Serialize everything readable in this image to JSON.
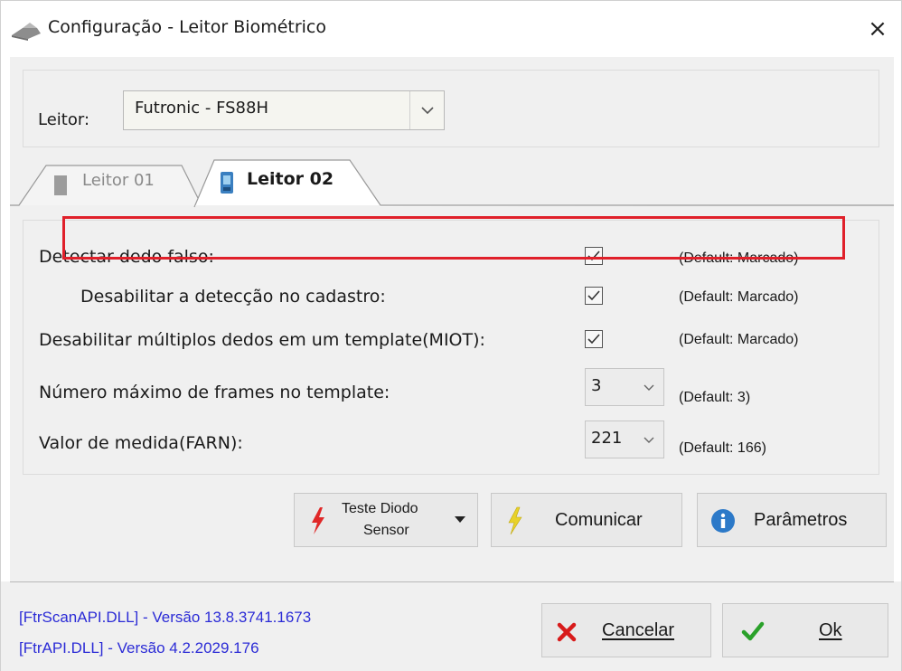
{
  "window": {
    "title": "Configuração - Leitor Biométrico",
    "close_glyph": "×"
  },
  "leitor": {
    "label": "Leitor:",
    "selected": "Futronic - FS88H"
  },
  "tabs": [
    {
      "label": "Leitor 01",
      "active": false
    },
    {
      "label": "Leitor 02",
      "active": true
    }
  ],
  "options": {
    "detectar_dedo_falso": {
      "label": "Detectar dedo falso:",
      "checked": true,
      "default": "(Default: Marcado)"
    },
    "desabilitar_deteccao": {
      "label": "Desabilitar a detecção no cadastro:",
      "checked": true,
      "default": "(Default: Marcado)"
    },
    "desabilitar_multiplos": {
      "label": "Desabilitar múltiplos dedos em um template(MIOT):",
      "checked": true,
      "default": "(Default: Marcado)"
    },
    "numero_frames": {
      "label": "Número máximo de frames no template:",
      "value": "3",
      "default": "(Default: 3)"
    },
    "valor_medida": {
      "label": "Valor de medida(FARN):",
      "value": "221",
      "default": "(Default: 166)"
    }
  },
  "buttons": {
    "teste_line1": "Teste Diodo",
    "teste_line2": "Sensor",
    "comunicar": "Comunicar",
    "parametros": "Parâmetros",
    "cancelar": "Cancelar",
    "ok": "Ok"
  },
  "status": {
    "line1": "[FtrScanAPI.DLL] - Versão 13.8.3741.1673",
    "line2": "[FtrAPI.DLL] - Versão 4.2.2029.176"
  },
  "colors": {
    "highlight": "#e0202a",
    "info_text": "#2b2bd6",
    "cancel_x": "#d81b1b",
    "ok_check": "#2aa12a"
  }
}
